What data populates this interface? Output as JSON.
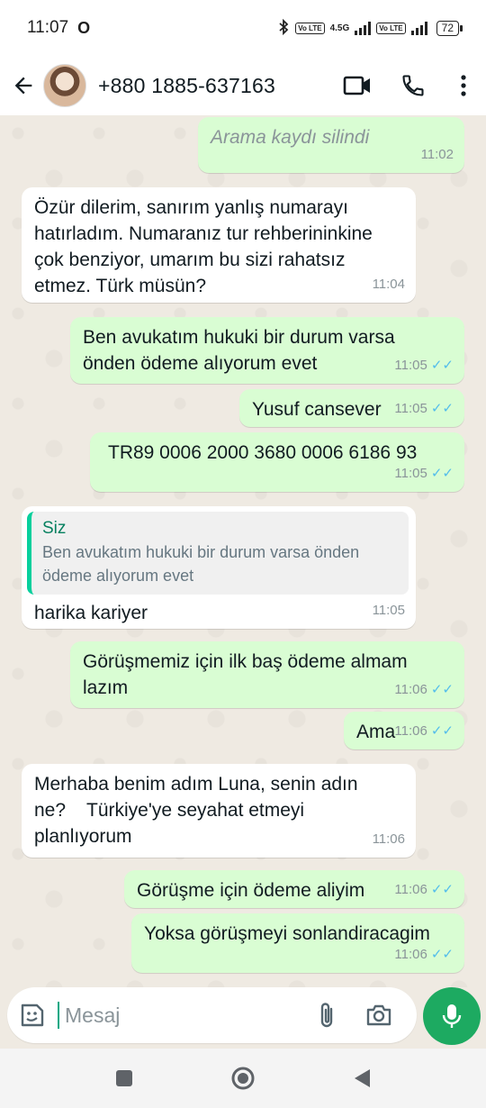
{
  "status_bar": {
    "time": "11:07",
    "app_indicator": "O",
    "network_label": "4.5G",
    "volte_label": "Vo LTE",
    "battery": "72"
  },
  "header": {
    "contact": "+880 1885-637163",
    "icons": [
      "back-arrow-icon",
      "video-call-icon",
      "phone-icon",
      "more-vert-icon"
    ]
  },
  "messages": [
    {
      "text": "Arama kaydı silindi",
      "time": "11:02"
    },
    {
      "text": "Özür dilerim, sanırım yanlış numarayı hatırladım. Numaranız tur rehberininkine çok benziyor, umarım bu sizi rahatsız etmez. Türk müsün?",
      "time": "11:04"
    },
    {
      "text": "Ben avukatım hukuki bir durum varsa önden ödeme alıyorum evet",
      "time": "11:05"
    },
    {
      "text": "Yusuf cansever",
      "time": "11:05"
    },
    {
      "text": "TR89 0006 2000 3680 0006 6186 93",
      "time": "11:05"
    },
    {
      "quote_author": "Siz",
      "quote_text": "Ben avukatım hukuki bir durum varsa önden ödeme alıyorum evet",
      "text": "harika kariyer",
      "time": "11:05"
    },
    {
      "text": "Görüşmemiz için ilk baş ödeme almam lazım",
      "time": "11:06"
    },
    {
      "text": "Ama",
      "time": "11:06"
    },
    {
      "text": "Merhaba benim adım Luna, senin adın ne?    Türkiye'ye seyahat etmeyi planlıyorum",
      "time": "11:06"
    },
    {
      "text": "Görüşme için ödeme aliyim",
      "time": "11:06"
    },
    {
      "text": "Yoksa görüşmeyi sonlandiracagim",
      "time": "11:06"
    }
  ],
  "composer": {
    "placeholder": "Mesaj",
    "icons": [
      "sticker-icon",
      "attach-icon",
      "camera-icon",
      "mic-icon"
    ]
  },
  "nav": {
    "icons": [
      "recents-square-icon",
      "home-circle-icon",
      "back-triangle-icon"
    ]
  },
  "colors": {
    "chat_bg": "#efeae2",
    "incoming": "#ffffff",
    "outgoing": "#d9fdd3",
    "read_ticks": "#53bdeb",
    "accent_green": "#1daa61"
  }
}
